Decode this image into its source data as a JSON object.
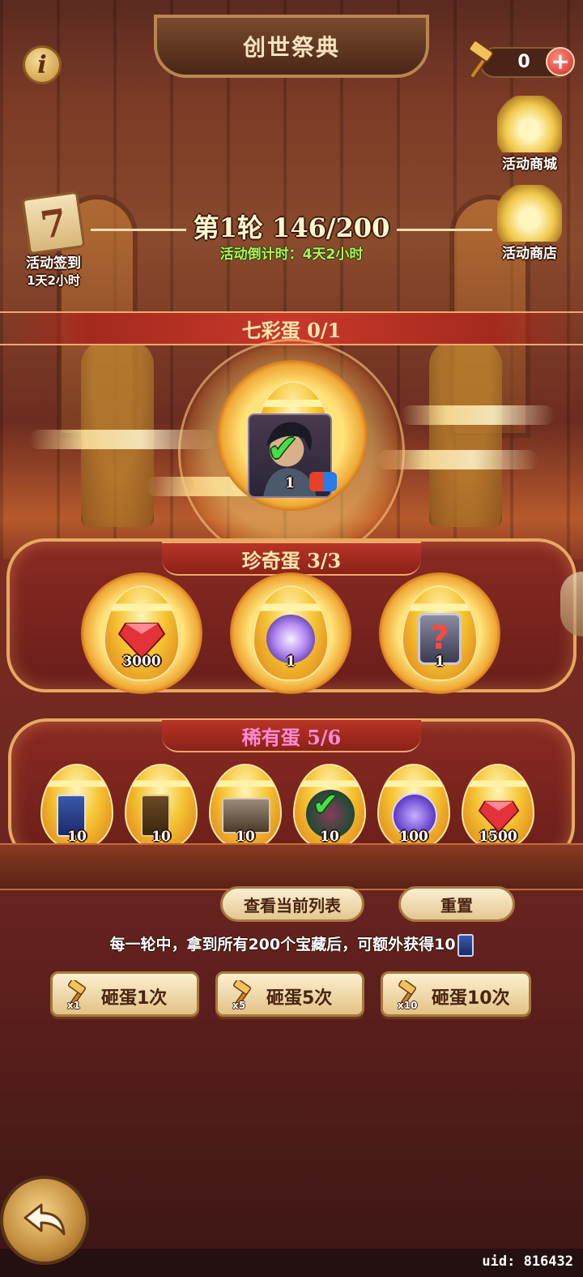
{
  "header": {
    "title": "创世祭典",
    "info_label": "i",
    "hammer_count": "0",
    "plus_label": "+"
  },
  "side_buttons": {
    "shop_mall": "活动商城",
    "shop_store": "活动商店",
    "signin_label": "活动签到",
    "signin_timer": "1天2小时",
    "signin_day": "7"
  },
  "round": {
    "title": "第1轮 146/200",
    "countdown": "活动倒计时：4天2小时"
  },
  "sections": {
    "rainbow": {
      "title": "七彩蛋 0/1",
      "rewards": [
        {
          "item": "hero-portrait",
          "count": "1",
          "collected": true
        }
      ]
    },
    "treasure": {
      "title": "珍奇蛋 3/3",
      "rewards": [
        {
          "item": "red-gem",
          "count": "3000"
        },
        {
          "item": "magic-orb",
          "count": "1"
        },
        {
          "item": "mystery-badge",
          "count": "1"
        }
      ]
    },
    "rare": {
      "title": "稀有蛋 5/6",
      "rewards": [
        {
          "item": "blue-card",
          "count": "10"
        },
        {
          "item": "gold-card",
          "count": "10"
        },
        {
          "item": "treasure-chest",
          "count": "10"
        },
        {
          "item": "green-orb",
          "count": "10",
          "collected": true
        },
        {
          "item": "hammer-coin",
          "count": "100"
        },
        {
          "item": "red-gem",
          "count": "1500"
        }
      ]
    }
  },
  "actions": {
    "view_list": "查看当前列表",
    "reset": "重置",
    "hint": "每一轮中，拿到所有200个宝藏后，可额外获得10",
    "smash": [
      {
        "mult": "x1",
        "label": "砸蛋1次"
      },
      {
        "mult": "x5",
        "label": "砸蛋5次"
      },
      {
        "mult": "x10",
        "label": "砸蛋10次"
      }
    ]
  },
  "footer": {
    "uid": "uid: 816432"
  },
  "colors": {
    "panel_border": "#e8a860",
    "panel_fill": "#8a2a22",
    "ribbon": "#c8382a",
    "countdown_green": "#b6f05a",
    "check_green": "#4adc4a",
    "rare_pink": "#ff8ad6"
  }
}
